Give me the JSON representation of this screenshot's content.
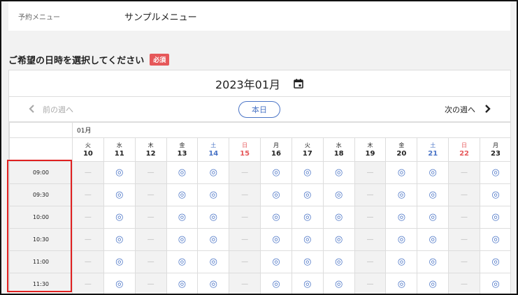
{
  "menu": {
    "label": "予約メニュー",
    "value": "サンプルメニュー"
  },
  "section": {
    "title": "ご希望の日時を選択してください",
    "badge": "必須"
  },
  "calendar": {
    "month_label": "2023年01月",
    "prev_week": "前の週へ",
    "today": "本日",
    "next_week": "次の週へ",
    "month_marker": "01月",
    "days": [
      {
        "dow": "火",
        "num": "10",
        "kind": "wk"
      },
      {
        "dow": "水",
        "num": "11",
        "kind": "wk"
      },
      {
        "dow": "木",
        "num": "12",
        "kind": "wk"
      },
      {
        "dow": "金",
        "num": "13",
        "kind": "wk"
      },
      {
        "dow": "土",
        "num": "14",
        "kind": "sat"
      },
      {
        "dow": "日",
        "num": "15",
        "kind": "sun"
      },
      {
        "dow": "月",
        "num": "16",
        "kind": "wk"
      },
      {
        "dow": "火",
        "num": "17",
        "kind": "wk"
      },
      {
        "dow": "水",
        "num": "18",
        "kind": "wk"
      },
      {
        "dow": "木",
        "num": "19",
        "kind": "wk"
      },
      {
        "dow": "金",
        "num": "20",
        "kind": "wk"
      },
      {
        "dow": "土",
        "num": "21",
        "kind": "sat"
      },
      {
        "dow": "日",
        "num": "22",
        "kind": "sun"
      },
      {
        "dow": "月",
        "num": "23",
        "kind": "wk"
      }
    ],
    "available_symbol": "◎",
    "unavailable_symbol": "—",
    "slots": [
      {
        "time": "09:00",
        "availability": [
          false,
          true,
          false,
          true,
          true,
          false,
          true,
          true,
          true,
          false,
          true,
          true,
          false,
          true
        ]
      },
      {
        "time": "09:30",
        "availability": [
          false,
          true,
          false,
          true,
          true,
          false,
          true,
          true,
          true,
          false,
          true,
          true,
          false,
          true
        ]
      },
      {
        "time": "10:00",
        "availability": [
          false,
          true,
          false,
          true,
          true,
          false,
          true,
          true,
          true,
          false,
          true,
          true,
          false,
          true
        ]
      },
      {
        "time": "10:30",
        "availability": [
          false,
          true,
          false,
          true,
          true,
          false,
          true,
          true,
          true,
          false,
          true,
          true,
          false,
          true
        ]
      },
      {
        "time": "11:00",
        "availability": [
          false,
          true,
          false,
          true,
          true,
          false,
          true,
          true,
          true,
          false,
          true,
          true,
          false,
          true
        ]
      },
      {
        "time": "11:30",
        "availability": [
          false,
          true,
          false,
          true,
          true,
          false,
          true,
          true,
          true,
          false,
          true,
          true,
          false,
          true
        ]
      }
    ]
  },
  "colors": {
    "accent": "#4a74c6",
    "required": "#e6585a",
    "highlight": "#e02020"
  }
}
